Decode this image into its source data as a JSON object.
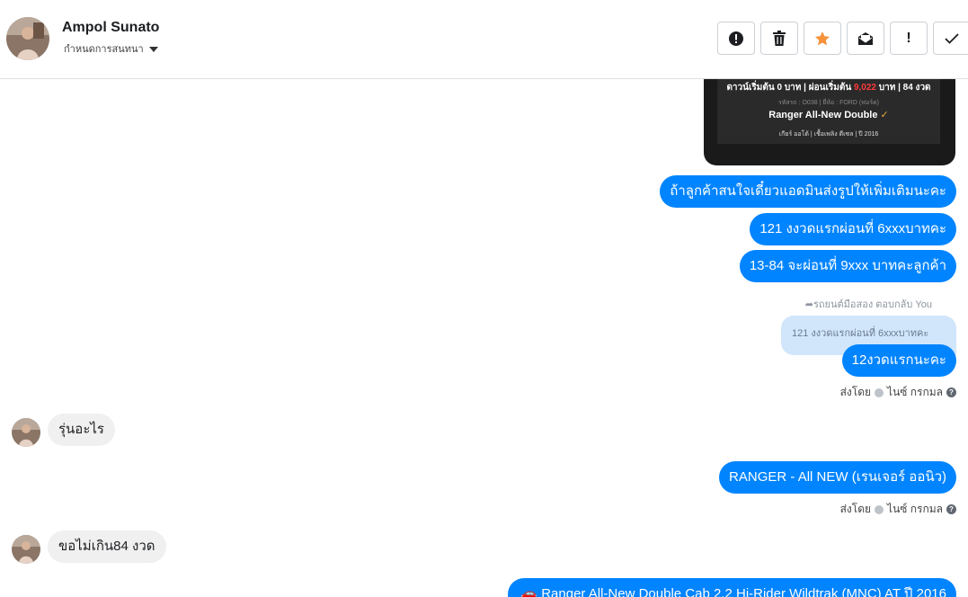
{
  "header": {
    "contact_name": "Ampol Sunato",
    "assign_label": "กำหนดการสนทนา"
  },
  "toolbar": {
    "buttons": [
      {
        "name": "spam-button",
        "icon": "exclamation-circle-icon"
      },
      {
        "name": "delete-button",
        "icon": "trash-icon"
      },
      {
        "name": "star-button",
        "icon": "star-icon",
        "color": "#f7923b"
      },
      {
        "name": "mark-unread-button",
        "icon": "envelope-icon"
      },
      {
        "name": "important-button",
        "icon": "exclamation-icon",
        "label": "!"
      },
      {
        "name": "done-button",
        "icon": "check-icon"
      }
    ]
  },
  "card": {
    "line1_a": "ดาวน์เริ่มต้น 0 บาท | ผ่อนเริ่มต้น ",
    "line1_price": "9,022",
    "line1_b": " บาท | 84 งวด",
    "line2": "รหัสรถ : O038 | ยี่ห้อ : FORD (ฟอร์ด)",
    "line3": "Ranger All-New Double",
    "line4": "เกียร์ ออโต้   |   เชื้อเพลิง ดีเซล   |   ปี 2016"
  },
  "messages": {
    "out1": "ถ้าลูกค้าสนใจเดี๋ยวแอดมินส่งรูปให้เพิ่มเติมนะคะ",
    "out2": "121 งงวดแรกผ่อนที่ 6xxxบาทคะ",
    "out3": "13-84 จะผ่อนที่ 9xxx บาทคะลูกค้า",
    "reply_note": "รถยนต์มือสอง ตอบกลับ You",
    "quoted": "121 งงวดแรกผ่อนที่ 6xxxบาทคะ",
    "out4": "12งวดแรกนะคะ",
    "sent_by_1": "ส่งโดย",
    "sender_1": "ไนซ์ กรกมล",
    "in1": "รุ่นอะไร",
    "out5": "RANGER - All NEW (เรนเจอร์ ออนิว)",
    "sent_by_2": "ส่งโดย",
    "sender_2": "ไนซ์ กรกมล",
    "in2": "ขอไม่เกิน84 งวด",
    "out6": "Ranger All-New Double Cab 2.2 Hi-Rider Wildtrak (MNC) AT ปี 2016"
  },
  "colors": {
    "outgoing_bubble": "#0084ff",
    "incoming_bubble": "#f0f0f0",
    "quote_bg": "#d1e6fb",
    "star": "#f7923b"
  }
}
